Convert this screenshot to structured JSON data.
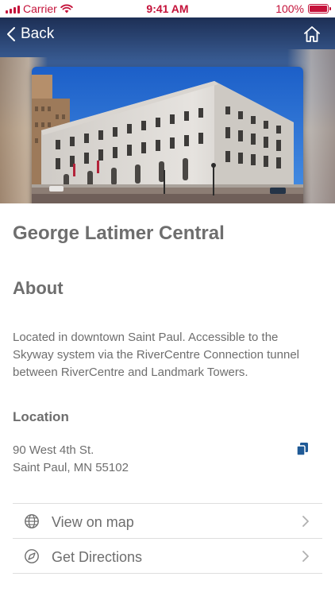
{
  "status_bar": {
    "carrier": "Carrier",
    "time": "9:41 AM",
    "battery_percent": "100%",
    "battery_level": 1.0,
    "accent_color": "#c4123a"
  },
  "nav": {
    "back_label": "Back",
    "back_icon": "chevron-left-icon",
    "home_icon": "home-icon"
  },
  "place": {
    "name": "George Latimer Central"
  },
  "about": {
    "heading": "About",
    "text": "Located in downtown Saint Paul. Accessible to the Skyway system via the RiverCentre Connection tunnel between RiverCentre and Landmark Towers."
  },
  "location": {
    "heading": "Location",
    "address_line1": "90 West 4th St.",
    "address_line2": "Saint Paul, MN 55102",
    "copy_icon": "copy-icon",
    "copy_icon_color": "#1f5a96"
  },
  "actions": [
    {
      "label": "View on map",
      "icon": "globe-icon"
    },
    {
      "label": "Get Directions",
      "icon": "compass-icon"
    }
  ],
  "colors": {
    "text_gray": "#6e6e6e",
    "divider": "#dedede"
  }
}
